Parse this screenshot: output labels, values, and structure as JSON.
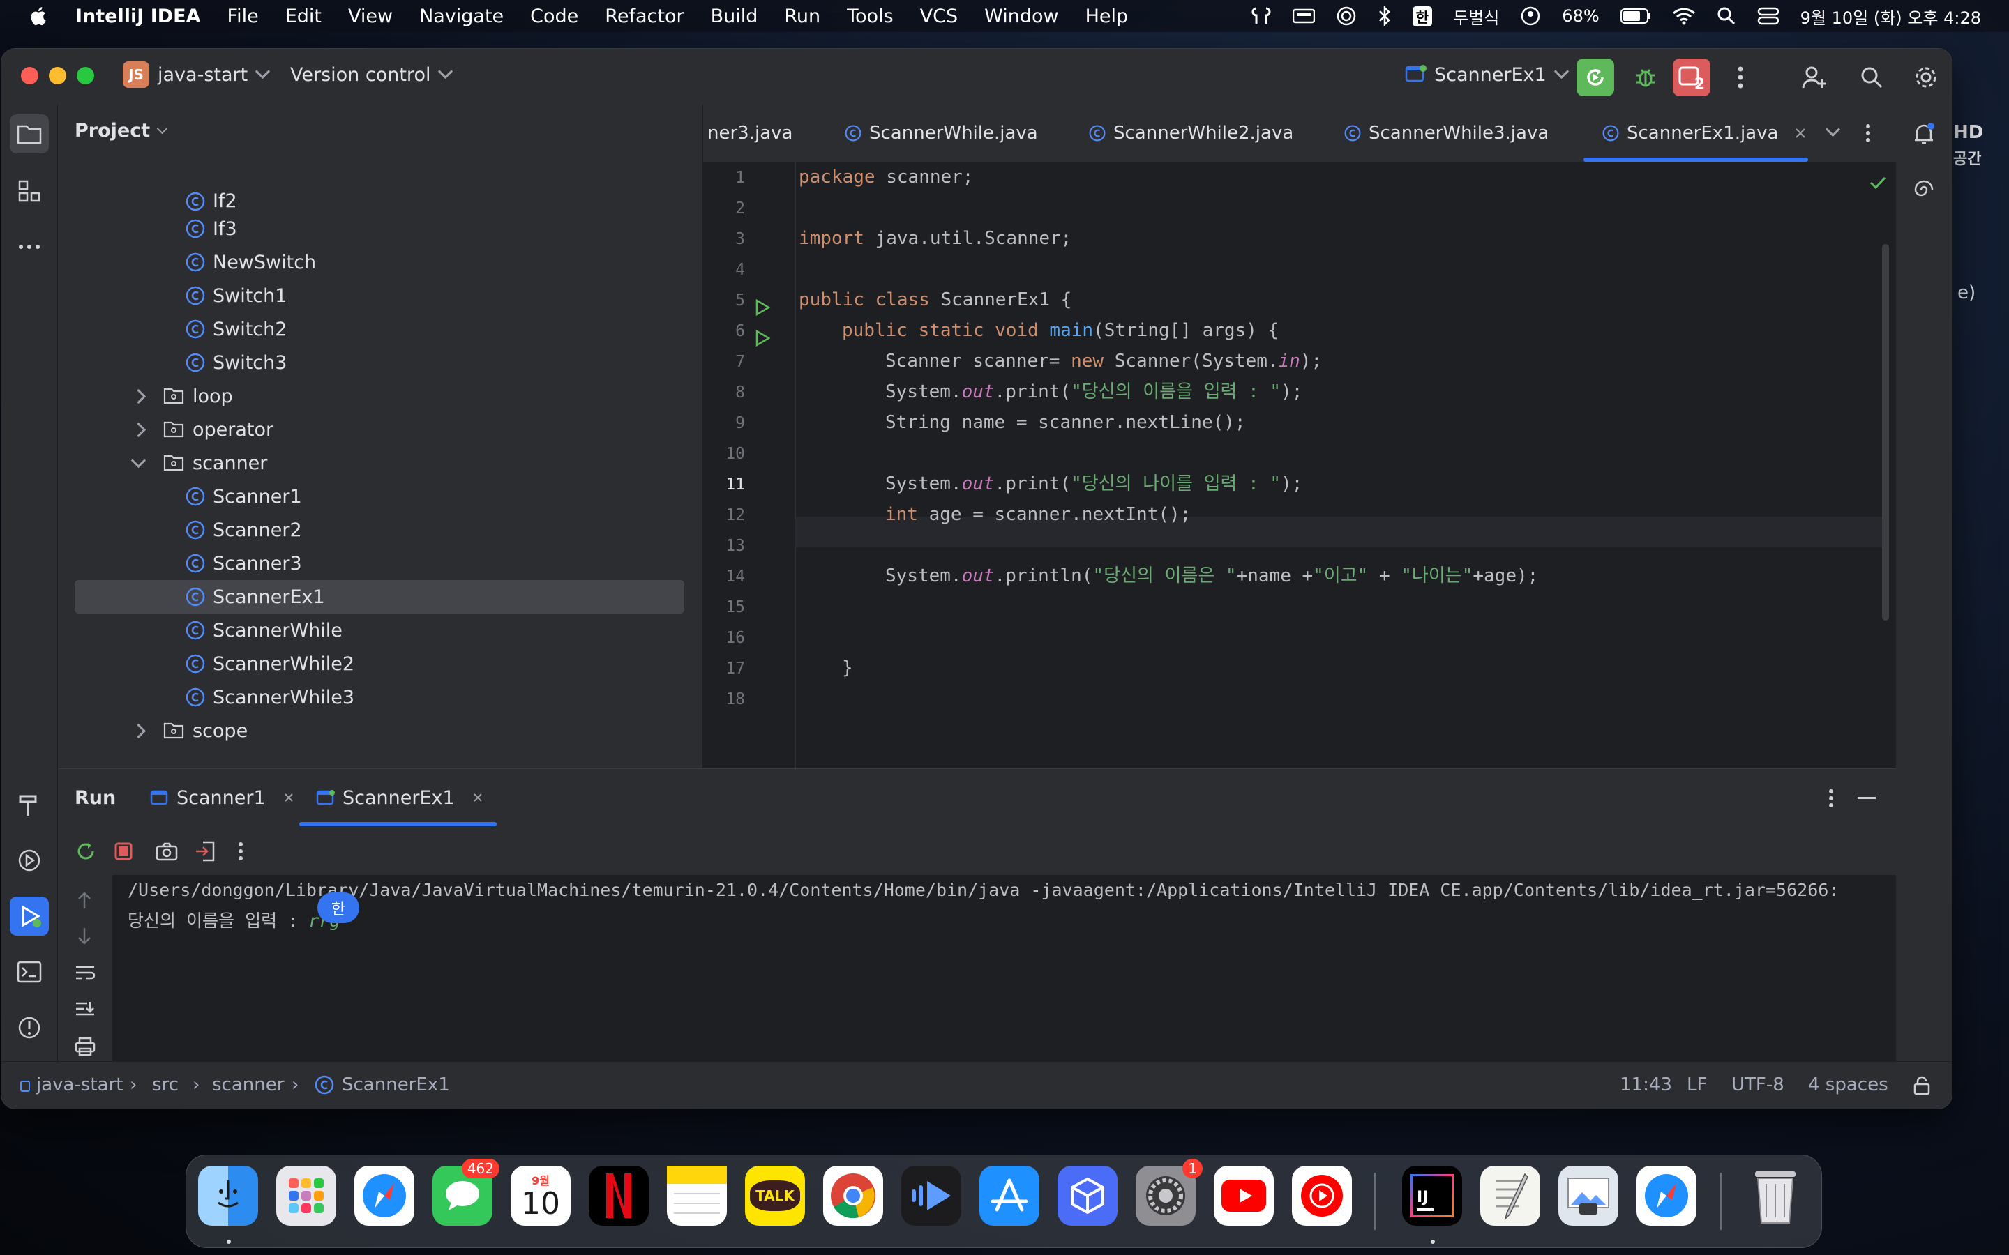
{
  "menubar": {
    "app_name": "IntelliJ IDEA",
    "items": [
      "File",
      "Edit",
      "View",
      "Navigate",
      "Code",
      "Refactor",
      "Build",
      "Run",
      "Tools",
      "VCS",
      "Window",
      "Help"
    ],
    "input_method": "한",
    "input_label": "두벌식",
    "battery": "68%",
    "datetime": "9월 10일 (화) 오후 4:28"
  },
  "titlebar": {
    "project_badge": "JS",
    "project_name": "java-start",
    "vcs_label": "Version control",
    "run_config": "ScannerEx1",
    "stop_count": "2"
  },
  "project_panel": {
    "title": "Project",
    "items": [
      {
        "label": "If2",
        "kind": "class"
      },
      {
        "label": "If3",
        "kind": "class"
      },
      {
        "label": "NewSwitch",
        "kind": "class"
      },
      {
        "label": "Switch1",
        "kind": "class"
      },
      {
        "label": "Switch2",
        "kind": "class"
      },
      {
        "label": "Switch3",
        "kind": "class"
      },
      {
        "label": "loop",
        "kind": "package-collapsed"
      },
      {
        "label": "operator",
        "kind": "package-collapsed"
      },
      {
        "label": "scanner",
        "kind": "package-expanded"
      },
      {
        "label": "Scanner1",
        "kind": "class"
      },
      {
        "label": "Scanner2",
        "kind": "class"
      },
      {
        "label": "Scanner3",
        "kind": "class"
      },
      {
        "label": "ScannerEx1",
        "kind": "class",
        "selected": true
      },
      {
        "label": "ScannerWhile",
        "kind": "class"
      },
      {
        "label": "ScannerWhile2",
        "kind": "class"
      },
      {
        "label": "ScannerWhile3",
        "kind": "class"
      },
      {
        "label": "scope",
        "kind": "package-collapsed"
      }
    ]
  },
  "editor": {
    "tabs": [
      "ner3.java",
      "ScannerWhile.java",
      "ScannerWhile2.java",
      "ScannerWhile3.java",
      "ScannerEx1.java"
    ],
    "active_tab": "ScannerEx1.java",
    "line_numbers": [
      "1",
      "2",
      "3",
      "4",
      "5",
      "6",
      "7",
      "8",
      "9",
      "10",
      "11",
      "12",
      "13",
      "14",
      "15",
      "16",
      "17",
      "18"
    ],
    "code": {
      "l1_kw": "package",
      "l1_rest": " scanner;",
      "l3_kw": "import",
      "l3_rest": " java.util.Scanner;",
      "l5_kw": "public class",
      "l5_rest": " ScannerEx1 {",
      "l6_kw": "public static void",
      "l6_fn": "main",
      "l6_rest": "(String[] args) {",
      "l7_a": "Scanner scanner= ",
      "l7_kw": "new",
      "l7_b": " Scanner(System.",
      "l7_st": "in",
      "l7_c": ");",
      "l8_a": "System.",
      "l8_st": "out",
      "l8_b": ".print(",
      "l8_str": "\"당신의 이름을 입력 : \"",
      "l8_c": ");",
      "l9": "String name = scanner.nextLine();",
      "l11_a": "System.",
      "l11_st": "out",
      "l11_b": ".print(",
      "l11_str": "\"당신의 나이를 입력 : \"",
      "l11_c": ");",
      "l12_kw": "int",
      "l12_rest": " age = scanner.nextInt();",
      "l14_a": "System.",
      "l14_st": "out",
      "l14_b": ".println(",
      "l14_str1": "\"당신의 이름은 \"",
      "l14_c": "+name +",
      "l14_str2": "\"이고\"",
      "l14_d": " + ",
      "l14_str3": "\"나이는\"",
      "l14_e": "+age);",
      "l17": "}"
    }
  },
  "run_panel": {
    "title": "Run",
    "tabs": [
      "Scanner1",
      "ScannerEx1"
    ],
    "active_tab": "ScannerEx1",
    "console_cmd": "/Users/donggon/Library/Java/JavaVirtualMachines/temurin-21.0.4/Contents/Home/bin/java -javaagent:/Applications/IntelliJ IDEA CE.app/Contents/lib/idea_rt.jar=56266:",
    "console_prompt": "당신의 이름을 입력 : ",
    "console_input": "rrg",
    "ime_indicator": "한"
  },
  "statusbar": {
    "breadcrumb": [
      "java-start",
      "src",
      "scanner",
      "ScannerEx1"
    ],
    "position": "11:43",
    "line_sep": "LF",
    "encoding": "UTF-8",
    "indent": "4 spaces"
  },
  "desktop_fragments": [
    "HD",
    "공간",
    "e)"
  ],
  "dock": {
    "messages_badge": "462",
    "calendar_month": "9월",
    "calendar_day": "10",
    "settings_badge": "1",
    "kakao_label": "TALK",
    "ij_label": "IJ"
  },
  "colors": {
    "accent": "#3574f0",
    "keyword": "#cf8e6d",
    "string": "#6aab73",
    "function": "#56a8f5",
    "static": "#c77dbb",
    "run_green": "#5fb85c",
    "stop_red": "#db5c5c"
  }
}
